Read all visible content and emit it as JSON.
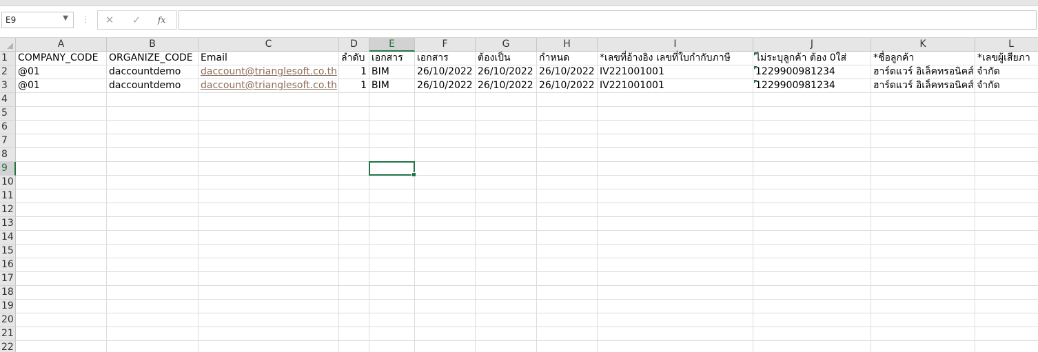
{
  "name_box": {
    "value": "E9"
  },
  "formula_bar": {
    "cancel_glyph": "✕",
    "enter_glyph": "✓",
    "fx_label": "fx",
    "value": ""
  },
  "selected": {
    "col": "E",
    "row": "9"
  },
  "columns": [
    {
      "key": "A",
      "label": "A"
    },
    {
      "key": "B",
      "label": "B"
    },
    {
      "key": "C",
      "label": "C"
    },
    {
      "key": "D",
      "label": "D"
    },
    {
      "key": "E",
      "label": "E"
    },
    {
      "key": "F",
      "label": "F"
    },
    {
      "key": "G",
      "label": "G"
    },
    {
      "key": "H",
      "label": "H"
    },
    {
      "key": "I",
      "label": "I"
    },
    {
      "key": "J",
      "label": "J"
    },
    {
      "key": "K",
      "label": "K"
    },
    {
      "key": "L",
      "label": "L"
    }
  ],
  "rows": [
    {
      "num": "1",
      "cells": {
        "A": "COMPANY_CODE",
        "B": "ORGANIZE_CODE",
        "C": "Email",
        "D": "ลำดับ",
        "E": "เอกสาร",
        "F": "เอกสาร",
        "G": "ต้องเป็น",
        "H": "กำหนด",
        "I": "*เลขที่อ้างอิง  เลขที่ใบกำกับภาษี",
        "J": "ไม่ระบุลูกค้า ต้อง 0ใส่",
        "K": "*ชื่อลูกค้า",
        "L": "*เลขผู้เสียภา"
      }
    },
    {
      "num": "2",
      "cells": {
        "A": "@01",
        "B": "daccountdemo",
        "C": "daccount@trianglesoft.co.th",
        "D": "1",
        "E": "BIM",
        "F": "26/10/2022",
        "G": "26/10/2022",
        "H": "26/10/2022",
        "I": "IV221001001",
        "J": "1229900981234",
        "K": "ฮาร์ดแวร์ อิเล็คทรอนิคส์ จำกัด"
      }
    },
    {
      "num": "3",
      "cells": {
        "A": "@01",
        "B": "daccountdemo",
        "C": "daccount@trianglesoft.co.th",
        "D": "1",
        "E": "BIM",
        "F": "26/10/2022",
        "G": "26/10/2022",
        "H": "26/10/2022",
        "I": "IV221001001",
        "J": "1229900981234",
        "K": "ฮาร์ดแวร์ อิเล็คทรอนิคส์ จำกัด"
      }
    },
    {
      "num": "4",
      "cells": {}
    },
    {
      "num": "5",
      "cells": {}
    },
    {
      "num": "6",
      "cells": {}
    },
    {
      "num": "7",
      "cells": {}
    },
    {
      "num": "8",
      "cells": {}
    },
    {
      "num": "9",
      "cells": {}
    },
    {
      "num": "10",
      "cells": {}
    },
    {
      "num": "11",
      "cells": {}
    },
    {
      "num": "12",
      "cells": {}
    },
    {
      "num": "13",
      "cells": {}
    },
    {
      "num": "14",
      "cells": {}
    },
    {
      "num": "15",
      "cells": {}
    },
    {
      "num": "16",
      "cells": {}
    },
    {
      "num": "17",
      "cells": {}
    },
    {
      "num": "18",
      "cells": {}
    },
    {
      "num": "19",
      "cells": {}
    },
    {
      "num": "20",
      "cells": {}
    },
    {
      "num": "21",
      "cells": {}
    },
    {
      "num": "22",
      "cells": {}
    }
  ]
}
